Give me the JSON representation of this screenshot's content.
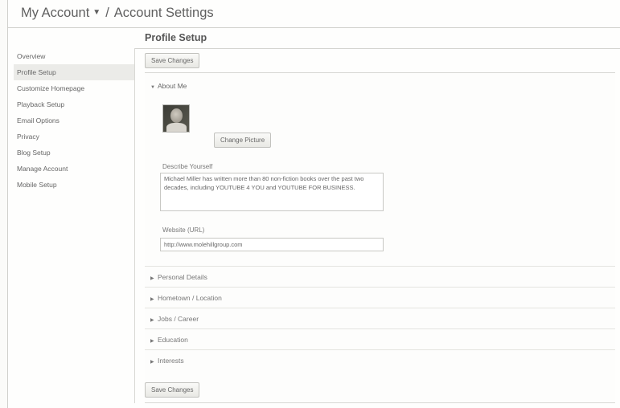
{
  "breadcrumb": {
    "account_label": "My Account",
    "separator": "/",
    "current_label": "Account Settings"
  },
  "page": {
    "title": "Profile Setup"
  },
  "sidebar": {
    "items": [
      {
        "label": "Overview"
      },
      {
        "label": "Profile Setup"
      },
      {
        "label": "Customize Homepage"
      },
      {
        "label": "Playback Setup"
      },
      {
        "label": "Email Options"
      },
      {
        "label": "Privacy"
      },
      {
        "label": "Blog Setup"
      },
      {
        "label": "Manage Account"
      },
      {
        "label": "Mobile Setup"
      }
    ],
    "active_index": 1
  },
  "actions": {
    "save_top_label": "Save Changes",
    "save_bottom_label": "Save Changes"
  },
  "about_me": {
    "header": "About Me",
    "change_picture_label": "Change Picture",
    "describe_label": "Describe Yourself",
    "describe_value": "Michael Miller has written more than 80 non-fiction books over the past two decades, including YOUTUBE 4 YOU and YOUTUBE FOR BUSINESS.",
    "website_label": "Website (URL)",
    "website_value": "http://www.molehillgroup.com"
  },
  "sections": [
    {
      "label": "Personal Details"
    },
    {
      "label": "Hometown / Location"
    },
    {
      "label": "Jobs / Career"
    },
    {
      "label": "Education"
    },
    {
      "label": "Interests"
    }
  ]
}
